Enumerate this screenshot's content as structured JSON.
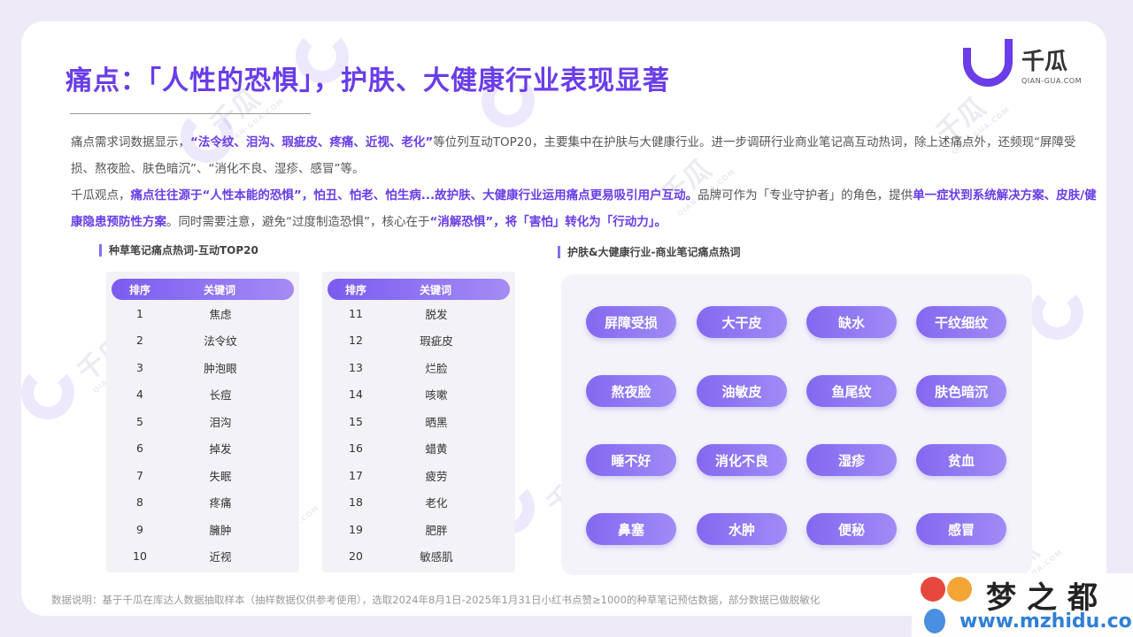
{
  "header": {
    "title": "痛点：「人性的恐惧」，护肤、大健康行业表现显著"
  },
  "logo": {
    "name": "千瓜",
    "domain": "QIAN-GUA.COM",
    "color": "#6a3de8"
  },
  "paragraph": {
    "p1": "痛点需求词数据显示，",
    "p1_hl": "“法令纹、泪沟、瑕疵皮、疼痛、近视、老化”",
    "p1b": "等位列互动TOP20，主要集中在护肤与大健康行业。进一步调研行业商业笔记高互动热词，除上述痛点外，还频现“屏障受损、熬夜脸、肤色暗沉”、“消化不良、湿疹、感冒”等。",
    "p2": "千瓜观点，",
    "p2_hl": "痛点往往源于“人性本能的恐惧”，怕丑、怕老、怕生病...故护肤、大健康行业运用痛点更易吸引用户互动。",
    "p2b": "品牌可作为「专业守护者」的角色，提供",
    "p2_hl2": "单一症状到系统解决方案、皮肤/健康隐患预防性方案",
    "p2c": "。同时需要注意，避免“过度制造恐惧”，核心在于",
    "p2_hl3": "“消解恐惧”，将「害怕」转化为「行动力」。"
  },
  "left_section": {
    "label": "种草笔记痛点热词-互动TOP20",
    "col_rank": "排序",
    "col_keyword": "关键词",
    "table1": [
      [
        "1",
        "焦虑"
      ],
      [
        "2",
        "法令纹"
      ],
      [
        "3",
        "肿泡眼"
      ],
      [
        "4",
        "长痘"
      ],
      [
        "5",
        "泪沟"
      ],
      [
        "6",
        "掉发"
      ],
      [
        "7",
        "失眠"
      ],
      [
        "8",
        "疼痛"
      ],
      [
        "9",
        "臃肿"
      ],
      [
        "10",
        "近视"
      ]
    ],
    "table2": [
      [
        "11",
        "脱发"
      ],
      [
        "12",
        "瑕疵皮"
      ],
      [
        "13",
        "烂脸"
      ],
      [
        "14",
        "咳嗽"
      ],
      [
        "15",
        "晒黑"
      ],
      [
        "16",
        "蜡黄"
      ],
      [
        "17",
        "疲劳"
      ],
      [
        "18",
        "老化"
      ],
      [
        "19",
        "肥胖"
      ],
      [
        "20",
        "敏感肌"
      ]
    ]
  },
  "right_section": {
    "label": "护肤&大健康行业-商业笔记痛点热词",
    "tags": [
      "屏障受损",
      "大干皮",
      "缺水",
      "干纹细纹",
      "熬夜脸",
      "油敏皮",
      "鱼尾纹",
      "肤色暗沉",
      "睡不好",
      "消化不良",
      "湿疹",
      "贫血",
      "鼻塞",
      "水肿",
      "便秘",
      "感冒"
    ]
  },
  "footer": {
    "note": "数据说明：基于千瓜在库达人数据抽取样本（抽样数据仅供参考使用），选取2024年8月1日-2025年1月31日小红书点赞≥1000的种草笔记预估数据，部分数据已做脱敏化",
    "brand_name": "梦之都",
    "brand_url": "www.mzhidu.com"
  }
}
